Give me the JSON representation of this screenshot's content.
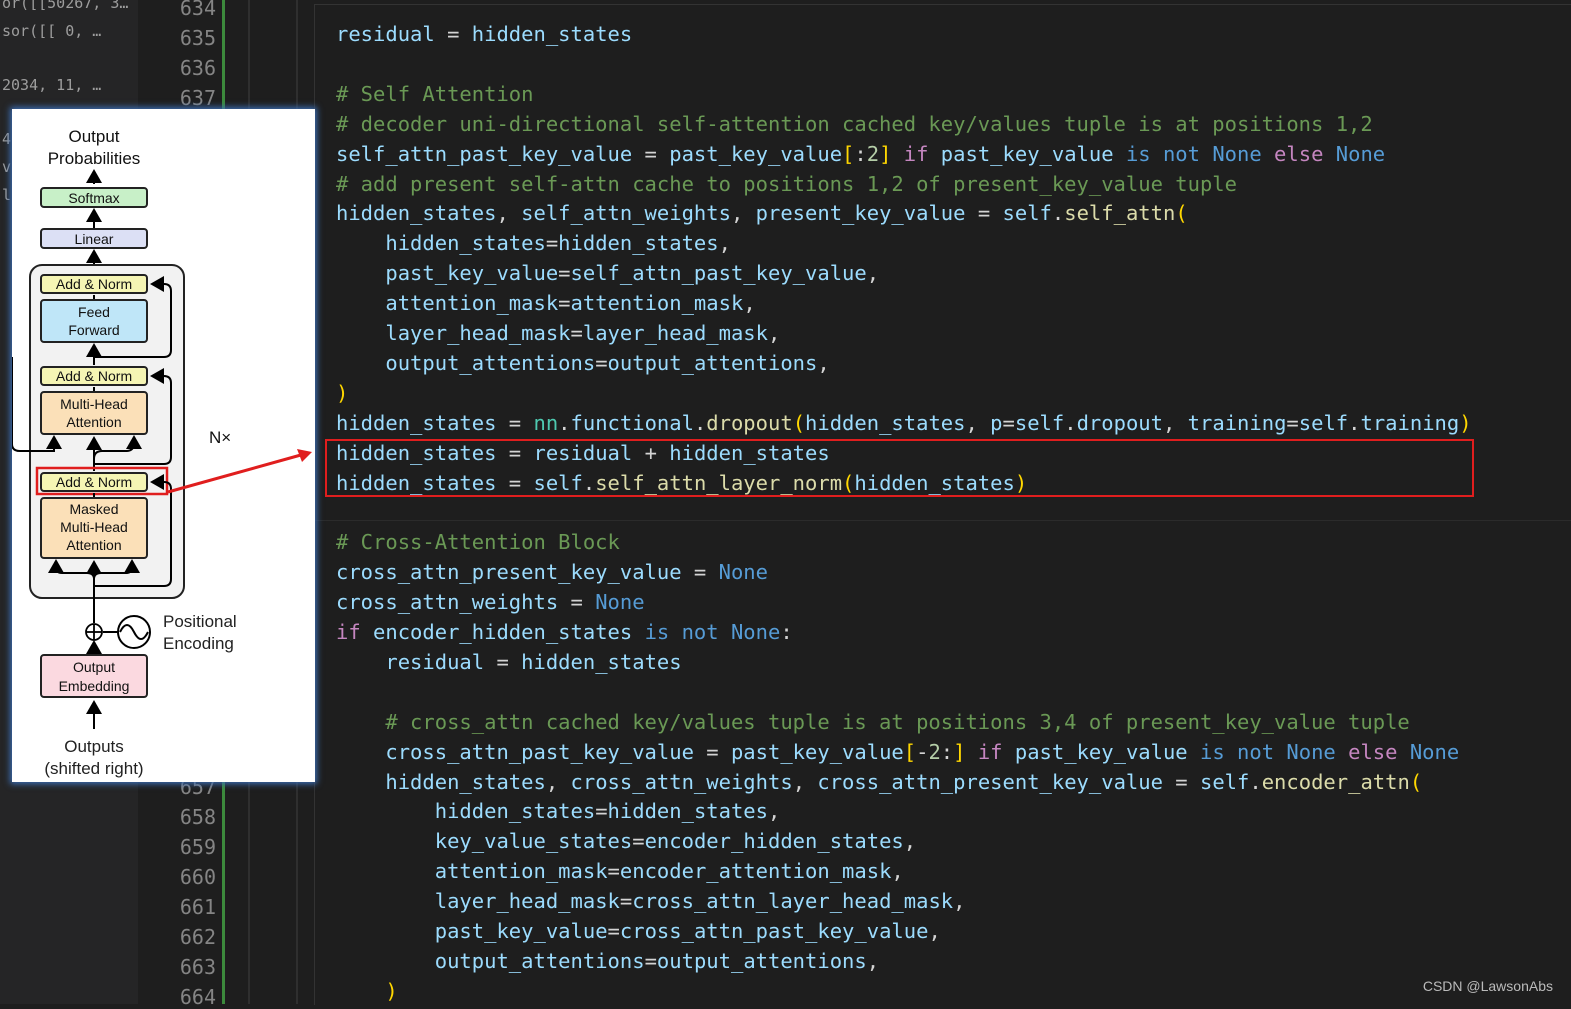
{
  "left_panel": {
    "lines": [
      "or([[50267,  3…",
      "sor([[    0,  …",
      "",
      "2034,    11,  …",
      "",
      "4",
      "v",
      "l"
    ]
  },
  "gutter": {
    "numbers_top": [
      "634",
      "635",
      "636",
      "637"
    ],
    "numbers_bottom": [
      "657",
      "658",
      "659",
      "660",
      "661",
      "662",
      "663",
      "664"
    ]
  },
  "code": [
    [
      [
        "var",
        "residual"
      ],
      [
        "op",
        " = "
      ],
      [
        "var",
        "hidden_states"
      ]
    ],
    [],
    [
      [
        "com",
        "# Self Attention"
      ]
    ],
    [
      [
        "com",
        "# decoder uni-directional self-attention cached key/values tuple is at positions 1,2"
      ]
    ],
    [
      [
        "var",
        "self_attn_past_key_value"
      ],
      [
        "op",
        " = "
      ],
      [
        "var",
        "past_key_value"
      ],
      [
        "br1",
        "["
      ],
      [
        "op",
        ":"
      ],
      [
        "num",
        "2"
      ],
      [
        "br1",
        "]"
      ],
      [
        "op",
        " "
      ],
      [
        "kw",
        "if"
      ],
      [
        "op",
        " "
      ],
      [
        "var",
        "past_key_value"
      ],
      [
        "op",
        " "
      ],
      [
        "const",
        "is not None"
      ],
      [
        "op",
        " "
      ],
      [
        "kw",
        "else"
      ],
      [
        "op",
        " "
      ],
      [
        "const",
        "None"
      ]
    ],
    [
      [
        "com",
        "# add present self-attn cache to positions 1,2 of present_key_value tuple"
      ]
    ],
    [
      [
        "var",
        "hidden_states"
      ],
      [
        "op",
        ", "
      ],
      [
        "var",
        "self_attn_weights"
      ],
      [
        "op",
        ", "
      ],
      [
        "var",
        "present_key_value"
      ],
      [
        "op",
        " = "
      ],
      [
        "var",
        "self"
      ],
      [
        "op",
        "."
      ],
      [
        "fn",
        "self_attn"
      ],
      [
        "br1",
        "("
      ]
    ],
    [
      [
        "op",
        "    "
      ],
      [
        "var",
        "hidden_states"
      ],
      [
        "op",
        "="
      ],
      [
        "var",
        "hidden_states"
      ],
      [
        "op",
        ","
      ]
    ],
    [
      [
        "op",
        "    "
      ],
      [
        "var",
        "past_key_value"
      ],
      [
        "op",
        "="
      ],
      [
        "var",
        "self_attn_past_key_value"
      ],
      [
        "op",
        ","
      ]
    ],
    [
      [
        "op",
        "    "
      ],
      [
        "var",
        "attention_mask"
      ],
      [
        "op",
        "="
      ],
      [
        "var",
        "attention_mask"
      ],
      [
        "op",
        ","
      ]
    ],
    [
      [
        "op",
        "    "
      ],
      [
        "var",
        "layer_head_mask"
      ],
      [
        "op",
        "="
      ],
      [
        "var",
        "layer_head_mask"
      ],
      [
        "op",
        ","
      ]
    ],
    [
      [
        "op",
        "    "
      ],
      [
        "var",
        "output_attentions"
      ],
      [
        "op",
        "="
      ],
      [
        "var",
        "output_attentions"
      ],
      [
        "op",
        ","
      ]
    ],
    [
      [
        "br1",
        ")"
      ]
    ],
    [
      [
        "var",
        "hidden_states"
      ],
      [
        "op",
        " = "
      ],
      [
        "mod",
        "nn"
      ],
      [
        "op",
        "."
      ],
      [
        "var",
        "functional"
      ],
      [
        "op",
        "."
      ],
      [
        "fn",
        "dropout"
      ],
      [
        "br1",
        "("
      ],
      [
        "var",
        "hidden_states"
      ],
      [
        "op",
        ", "
      ],
      [
        "var",
        "p"
      ],
      [
        "op",
        "="
      ],
      [
        "var",
        "self"
      ],
      [
        "op",
        "."
      ],
      [
        "var",
        "dropout"
      ],
      [
        "op",
        ", "
      ],
      [
        "var",
        "training"
      ],
      [
        "op",
        "="
      ],
      [
        "var",
        "self"
      ],
      [
        "op",
        "."
      ],
      [
        "var",
        "training"
      ],
      [
        "br1",
        ")"
      ]
    ],
    [
      [
        "var",
        "hidden_states"
      ],
      [
        "op",
        " = "
      ],
      [
        "var",
        "residual"
      ],
      [
        "op",
        " + "
      ],
      [
        "var",
        "hidden_states"
      ]
    ],
    [
      [
        "var",
        "hidden_states"
      ],
      [
        "op",
        " = "
      ],
      [
        "var",
        "self"
      ],
      [
        "op",
        "."
      ],
      [
        "fn",
        "self_attn_layer_norm"
      ],
      [
        "br1",
        "("
      ],
      [
        "var",
        "hidden_states"
      ],
      [
        "br1",
        ")"
      ]
    ],
    [],
    [
      [
        "com",
        "# Cross-Attention Block"
      ]
    ],
    [
      [
        "var",
        "cross_attn_present_key_value"
      ],
      [
        "op",
        " = "
      ],
      [
        "const",
        "None"
      ]
    ],
    [
      [
        "var",
        "cross_attn_weights"
      ],
      [
        "op",
        " = "
      ],
      [
        "const",
        "None"
      ]
    ],
    [
      [
        "kw",
        "if"
      ],
      [
        "op",
        " "
      ],
      [
        "var",
        "encoder_hidden_states"
      ],
      [
        "op",
        " "
      ],
      [
        "const",
        "is not None"
      ],
      [
        "op",
        ":"
      ]
    ],
    [
      [
        "op",
        "    "
      ],
      [
        "var",
        "residual"
      ],
      [
        "op",
        " = "
      ],
      [
        "var",
        "hidden_states"
      ]
    ],
    [],
    [
      [
        "op",
        "    "
      ],
      [
        "com",
        "# cross_attn cached key/values tuple is at positions 3,4 of present_key_value tuple"
      ]
    ],
    [
      [
        "op",
        "    "
      ],
      [
        "var",
        "cross_attn_past_key_value"
      ],
      [
        "op",
        " = "
      ],
      [
        "var",
        "past_key_value"
      ],
      [
        "br1",
        "["
      ],
      [
        "op",
        "-"
      ],
      [
        "num",
        "2"
      ],
      [
        "op",
        ":"
      ],
      [
        "br1",
        "]"
      ],
      [
        "op",
        " "
      ],
      [
        "kw",
        "if"
      ],
      [
        "op",
        " "
      ],
      [
        "var",
        "past_key_value"
      ],
      [
        "op",
        " "
      ],
      [
        "const",
        "is not None"
      ],
      [
        "op",
        " "
      ],
      [
        "kw",
        "else"
      ],
      [
        "op",
        " "
      ],
      [
        "const",
        "None"
      ]
    ],
    [
      [
        "op",
        "    "
      ],
      [
        "var",
        "hidden_states"
      ],
      [
        "op",
        ", "
      ],
      [
        "var",
        "cross_attn_weights"
      ],
      [
        "op",
        ", "
      ],
      [
        "var",
        "cross_attn_present_key_value"
      ],
      [
        "op",
        " = "
      ],
      [
        "var",
        "self"
      ],
      [
        "op",
        "."
      ],
      [
        "fn",
        "encoder_attn"
      ],
      [
        "br1",
        "("
      ]
    ],
    [
      [
        "op",
        "        "
      ],
      [
        "var",
        "hidden_states"
      ],
      [
        "op",
        "="
      ],
      [
        "var",
        "hidden_states"
      ],
      [
        "op",
        ","
      ]
    ],
    [
      [
        "op",
        "        "
      ],
      [
        "var",
        "key_value_states"
      ],
      [
        "op",
        "="
      ],
      [
        "var",
        "encoder_hidden_states"
      ],
      [
        "op",
        ","
      ]
    ],
    [
      [
        "op",
        "        "
      ],
      [
        "var",
        "attention_mask"
      ],
      [
        "op",
        "="
      ],
      [
        "var",
        "encoder_attention_mask"
      ],
      [
        "op",
        ","
      ]
    ],
    [
      [
        "op",
        "        "
      ],
      [
        "var",
        "layer_head_mask"
      ],
      [
        "op",
        "="
      ],
      [
        "var",
        "cross_attn_layer_head_mask"
      ],
      [
        "op",
        ","
      ]
    ],
    [
      [
        "op",
        "        "
      ],
      [
        "var",
        "past_key_value"
      ],
      [
        "op",
        "="
      ],
      [
        "var",
        "cross_attn_past_key_value"
      ],
      [
        "op",
        ","
      ]
    ],
    [
      [
        "op",
        "        "
      ],
      [
        "var",
        "output_attentions"
      ],
      [
        "op",
        "="
      ],
      [
        "var",
        "output_attentions"
      ],
      [
        "op",
        ","
      ]
    ],
    [
      [
        "op",
        "    "
      ],
      [
        "br1",
        ")"
      ]
    ]
  ],
  "diagram": {
    "output_probabilities": [
      "Output",
      "Probabilities"
    ],
    "softmax": "Softmax",
    "linear": "Linear",
    "add_norm": "Add & Norm",
    "feed_forward": [
      "Feed",
      "Forward"
    ],
    "multi_head_attention": [
      "Multi-Head",
      "Attention"
    ],
    "masked_attention": [
      "Masked",
      "Multi-Head",
      "Attention"
    ],
    "nx": "N×",
    "positional_encoding": [
      "Positional",
      "Encoding"
    ],
    "output_embedding": [
      "Output",
      "Embedding"
    ],
    "outputs": [
      "Outputs",
      "(shifted right)"
    ]
  },
  "watermark": "CSDN @LawsonAbs",
  "colors": {
    "highlight": "#e01e1e",
    "softmax_fill": "#c8f0c8",
    "linear_fill": "#dce0f5",
    "add_norm_fill": "#f5f5b4",
    "feed_forward_fill": "#bfe6f8",
    "attention_fill": "#fbe0b8",
    "embedding_fill": "#fbd9e0"
  }
}
